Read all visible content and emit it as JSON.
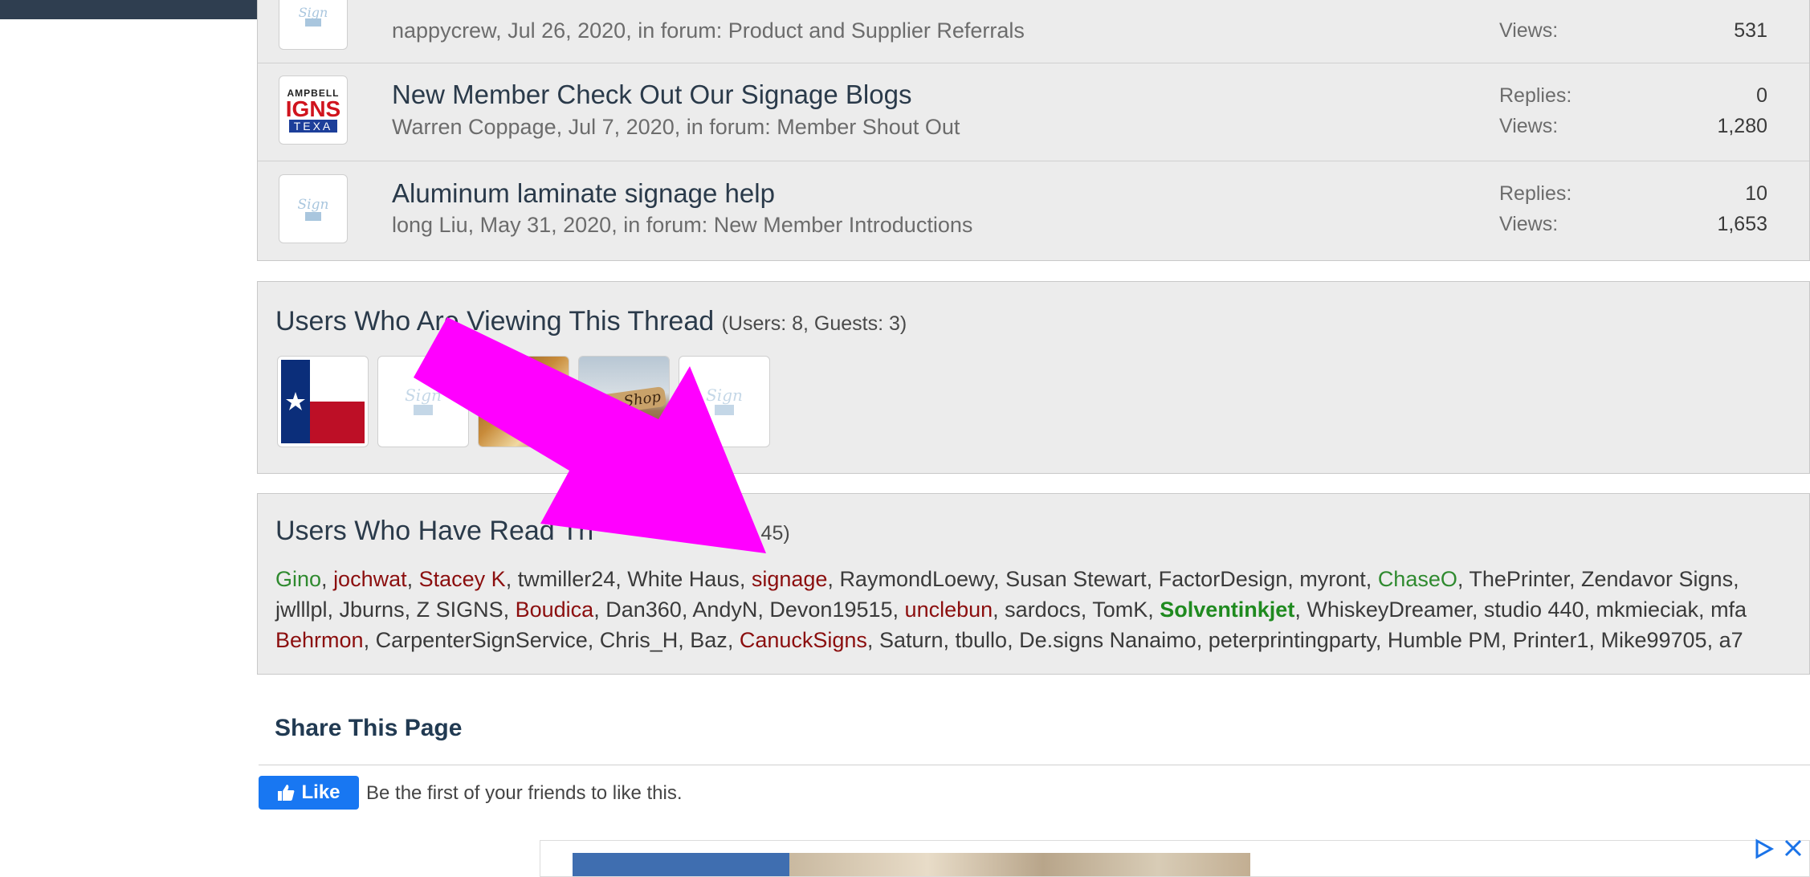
{
  "threads": [
    {
      "title": "",
      "meta": "nappycrew, Jul 26, 2020, in forum: Product and Supplier Referrals",
      "replies_label": "",
      "replies": "",
      "views_label": "Views:",
      "views": "531",
      "avatar": "sign101-logo"
    },
    {
      "title": "New Member Check Out Our Signage Blogs",
      "meta": "Warren Coppage, Jul 7, 2020, in forum: Member Shout Out",
      "replies_label": "Replies:",
      "replies": "0",
      "views_label": "Views:",
      "views": "1,280",
      "avatar": "campbell-signs-texas-logo",
      "avatar_text": {
        "l1": "AMPBELL",
        "l2": "IGNS",
        "l3": "TEXA"
      }
    },
    {
      "title": "Aluminum laminate signage help",
      "meta": "long Liu, May 31, 2020, in forum: New Member Introductions",
      "replies_label": "Replies:",
      "replies": "10",
      "views_label": "Views:",
      "views": "1,653",
      "avatar": "sign101-logo"
    }
  ],
  "viewing": {
    "title": "Users Who Are Viewing This Thread",
    "count": "(Users: 8, Guests: 3)",
    "avatars": [
      "texas-flag-avatar",
      "sign101-logo",
      "sign-shop-avatar",
      "sign-shop-avatar",
      "sign101-logo"
    ],
    "sign_shop_text": "Sign Shop"
  },
  "read": {
    "title": "Users Who Have Read Th",
    "count": "al: 45)",
    "names": [
      [
        "Gino",
        "jochwat",
        "Stacey K",
        "twmiller24",
        "White Haus",
        "signage",
        "RaymondLoewy",
        "Susan Stewart",
        "FactorDesign",
        "myront",
        "ChaseO",
        "ThePrinter",
        "Zendavor Signs,"
      ],
      [
        "jwlllpl",
        "Jburns",
        "Z SIGNS",
        "Boudica",
        "Dan360",
        "AndyN",
        "Devon19515",
        "unclebun",
        "sardocs",
        "TomK",
        "Solventinkjet",
        "WhiskeyDreamer",
        "studio 440",
        "mkmieciak",
        "mfa"
      ],
      [
        "Behrmon",
        "CarpenterSignService",
        "Chris_H",
        "Baz",
        "CanuckSigns",
        "Saturn",
        "tbullo",
        "De.signs Nanaimo",
        "peterprintingparty",
        "Humble PM",
        "Printer1",
        "Mike99705",
        "a7"
      ]
    ],
    "name_styles": {
      "Gino": "green",
      "jochwat": "red",
      "Stacey K": "red",
      "signage": "red",
      "ChaseO": "green",
      "Boudica": "red",
      "unclebun": "red",
      "Solventinkjet": "bold-green",
      "Behrmon": "red",
      "CanuckSigns": "red"
    }
  },
  "share": {
    "title": "Share This Page",
    "like_label": "Like",
    "like_text": "Be the first of your friends to like this."
  },
  "ad": {
    "icons": [
      "ad-choices-icon",
      "close-icon"
    ]
  },
  "colors": {
    "annotation_arrow": "#ff00ff",
    "topbar": "#2f3e50",
    "facebook_blue": "#1877f2",
    "name_red": "#8b0e0e",
    "name_green": "#2f8a2f"
  }
}
